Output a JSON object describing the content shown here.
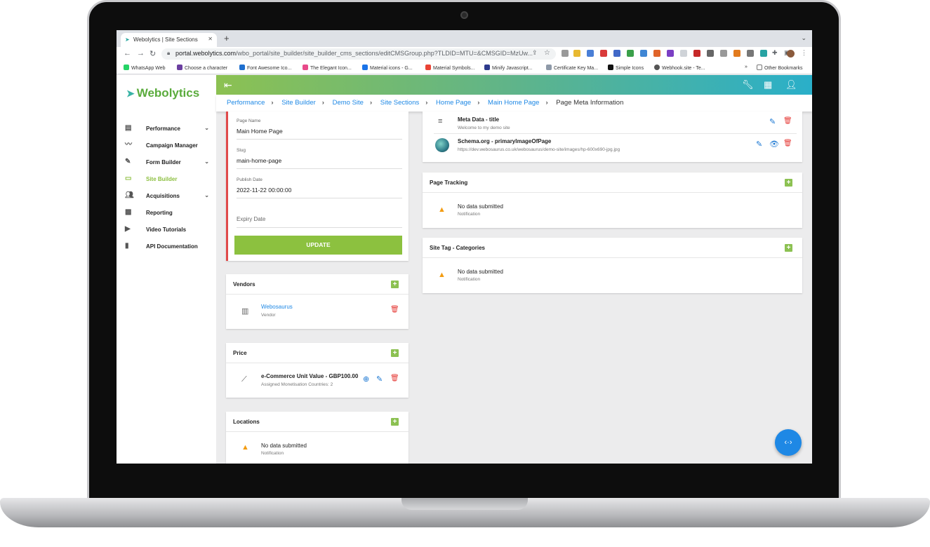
{
  "browser": {
    "tab_title": "Webolytics | Site Sections",
    "tab_icon": "webolytics-favicon",
    "url_domain": "portal.webolytics.com",
    "url_path": "/wbo_portal/site_builder/site_builder_cms_sections/editCMSGroup.php?TLDID=MTU=&CMSGID=MzUw...",
    "bookmarks": [
      "WhatsApp Web",
      "Choose a character",
      "Font Awesome Ico...",
      "The Elegant Icon...",
      "Material icons - G...",
      "Material Symbols...",
      "Minify Javascript...",
      "Certificate Key Ma...",
      "Simple Icons",
      "Webhook.site - Te..."
    ],
    "bookmarks_more": "»",
    "other_bookmarks": "Other Bookmarks"
  },
  "app": {
    "logo": "Webolytics",
    "accent": "#8cc152",
    "nav": [
      {
        "label": "Performance",
        "icon": "dashboard-icon",
        "chevron": true
      },
      {
        "label": "Campaign Manager",
        "icon": "trend-icon",
        "chevron": false
      },
      {
        "label": "Form Builder",
        "icon": "form-icon",
        "chevron": true
      },
      {
        "label": "Site Builder",
        "icon": "web-icon",
        "chevron": false,
        "active": true
      },
      {
        "label": "Acquisitions",
        "icon": "people-icon",
        "chevron": true
      },
      {
        "label": "Reporting",
        "icon": "report-icon",
        "chevron": false
      },
      {
        "label": "Video Tutorials",
        "icon": "video-icon",
        "chevron": false
      },
      {
        "label": "API Documentation",
        "icon": "book-icon",
        "chevron": false
      }
    ],
    "breadcrumbs": [
      "Performance",
      "Site Builder",
      "Demo Site",
      "Site Sections",
      "Home Page",
      "Main Home Page"
    ],
    "breadcrumb_current": "Page Meta Information"
  },
  "form": {
    "page_name_label": "Page Name",
    "page_name_value": "Main Home Page",
    "slug_label": "Slug",
    "slug_value": "main-home-page",
    "publish_label": "Publish Date",
    "publish_value": "2022-11-22 00:00:00",
    "expiry_label": "Expiry Date",
    "update_label": "UPDATE"
  },
  "vendors": {
    "title": "Vendors",
    "item_name": "Webosaurus",
    "item_sub": "Vendor"
  },
  "price": {
    "title": "Price",
    "item_name": "e-Commerce Unit Value - GBP100.00",
    "item_sub": "Assigned Monetisation Countries: 2"
  },
  "locations": {
    "title": "Locations",
    "empty": "No data submitted",
    "empty_sub": "Notification"
  },
  "meta": {
    "items": [
      {
        "title": "Meta Data - title",
        "sub": "Welcome to my demo site"
      },
      {
        "title": "Schema.org - primaryImageOfPage",
        "sub": "https://dev.webosaurus.co.uk/webosaurus/demo-site/images/hp-600x690-jpg.jpg"
      }
    ]
  },
  "tracking": {
    "title": "Page Tracking",
    "empty": "No data submitted",
    "empty_sub": "Notification"
  },
  "tags": {
    "title": "Site Tag - Categories",
    "empty": "No data submitted",
    "empty_sub": "Notification"
  }
}
